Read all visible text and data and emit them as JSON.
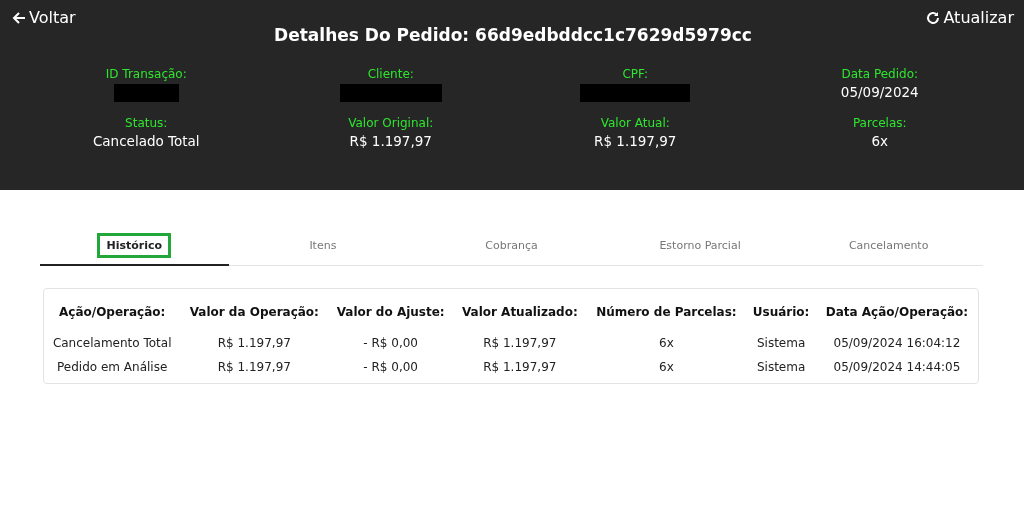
{
  "header": {
    "back": "Voltar",
    "refresh": "Atualizar",
    "title": "Detalhes Do Pedido: 66d9edbddcc1c7629d5979cc"
  },
  "fields": [
    {
      "label": "ID Transação:",
      "redacted": true
    },
    {
      "label": "Cliente:",
      "redacted": true
    },
    {
      "label": "CPF:",
      "redacted": true
    },
    {
      "label": "Data Pedido:",
      "value": "05/09/2024",
      "redacted": false
    },
    {
      "label": "Status:",
      "value": "Cancelado Total",
      "redacted": false
    },
    {
      "label": "Valor Original:",
      "value": "R$ 1.197,97",
      "redacted": false
    },
    {
      "label": "Valor Atual:",
      "value": "R$ 1.197,97",
      "redacted": false
    },
    {
      "label": "Parcelas:",
      "value": "6x",
      "redacted": false
    }
  ],
  "tabs": [
    {
      "label": "Histórico",
      "selected": true
    },
    {
      "label": "Itens",
      "selected": false
    },
    {
      "label": "Cobrança",
      "selected": false
    },
    {
      "label": "Estorno Parcial",
      "selected": false
    },
    {
      "label": "Cancelamento",
      "selected": false
    }
  ],
  "table": {
    "columns": [
      "Ação/Operação:",
      "Valor da Operação:",
      "Valor do Ajuste:",
      "Valor Atualizado:",
      "Número de Parcelas:",
      "Usuário:",
      "Data Ação/Operação:"
    ],
    "rows": [
      [
        "Cancelamento Total",
        "R$ 1.197,97",
        "- R$ 0,00",
        "R$ 1.197,97",
        "6x",
        "Sistema",
        "05/09/2024 16:04:12"
      ],
      [
        "Pedido em Análise",
        "R$ 1.197,97",
        "- R$ 0,00",
        "R$ 1.197,97",
        "6x",
        "Sistema",
        "05/09/2024 14:44:05"
      ]
    ]
  }
}
